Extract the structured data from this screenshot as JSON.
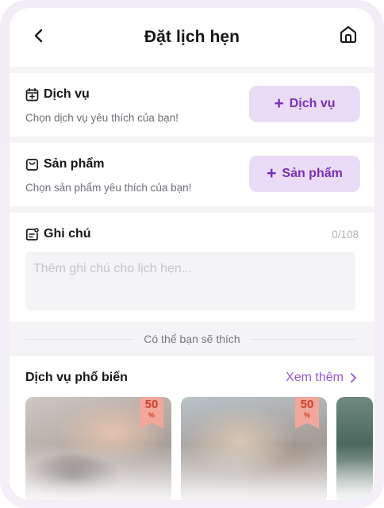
{
  "header": {
    "title": "Đặt lịch hẹn"
  },
  "service": {
    "title": "Dịch vụ",
    "subtitle": "Chọn dịch vụ yêu thích của bạn!",
    "button_label": "Dịch vụ"
  },
  "product": {
    "title": "Sản phẩm",
    "subtitle": "Chọn sản phẩm yêu thích của bạn!",
    "button_label": "Sản phẩm"
  },
  "note": {
    "title": "Ghi chú",
    "counter": "0/108",
    "placeholder": "Thêm ghi chú cho lịch hẹn..."
  },
  "suggest": {
    "text": "Có thể bạn sẽ thích"
  },
  "popular": {
    "title": "Dịch vụ phổ biến",
    "see_more": "Xem thêm",
    "cards": [
      {
        "discount": "50",
        "unit": "%"
      },
      {
        "discount": "50",
        "unit": "%"
      }
    ]
  },
  "colors": {
    "accent": "#7b2fb9",
    "accent_light": "#eadcf6",
    "link": "#9a56d4"
  },
  "icons": [
    "back-arrow-icon",
    "home-icon",
    "calendar-plus-icon",
    "bag-icon",
    "note-icon",
    "chevron-right-icon"
  ]
}
